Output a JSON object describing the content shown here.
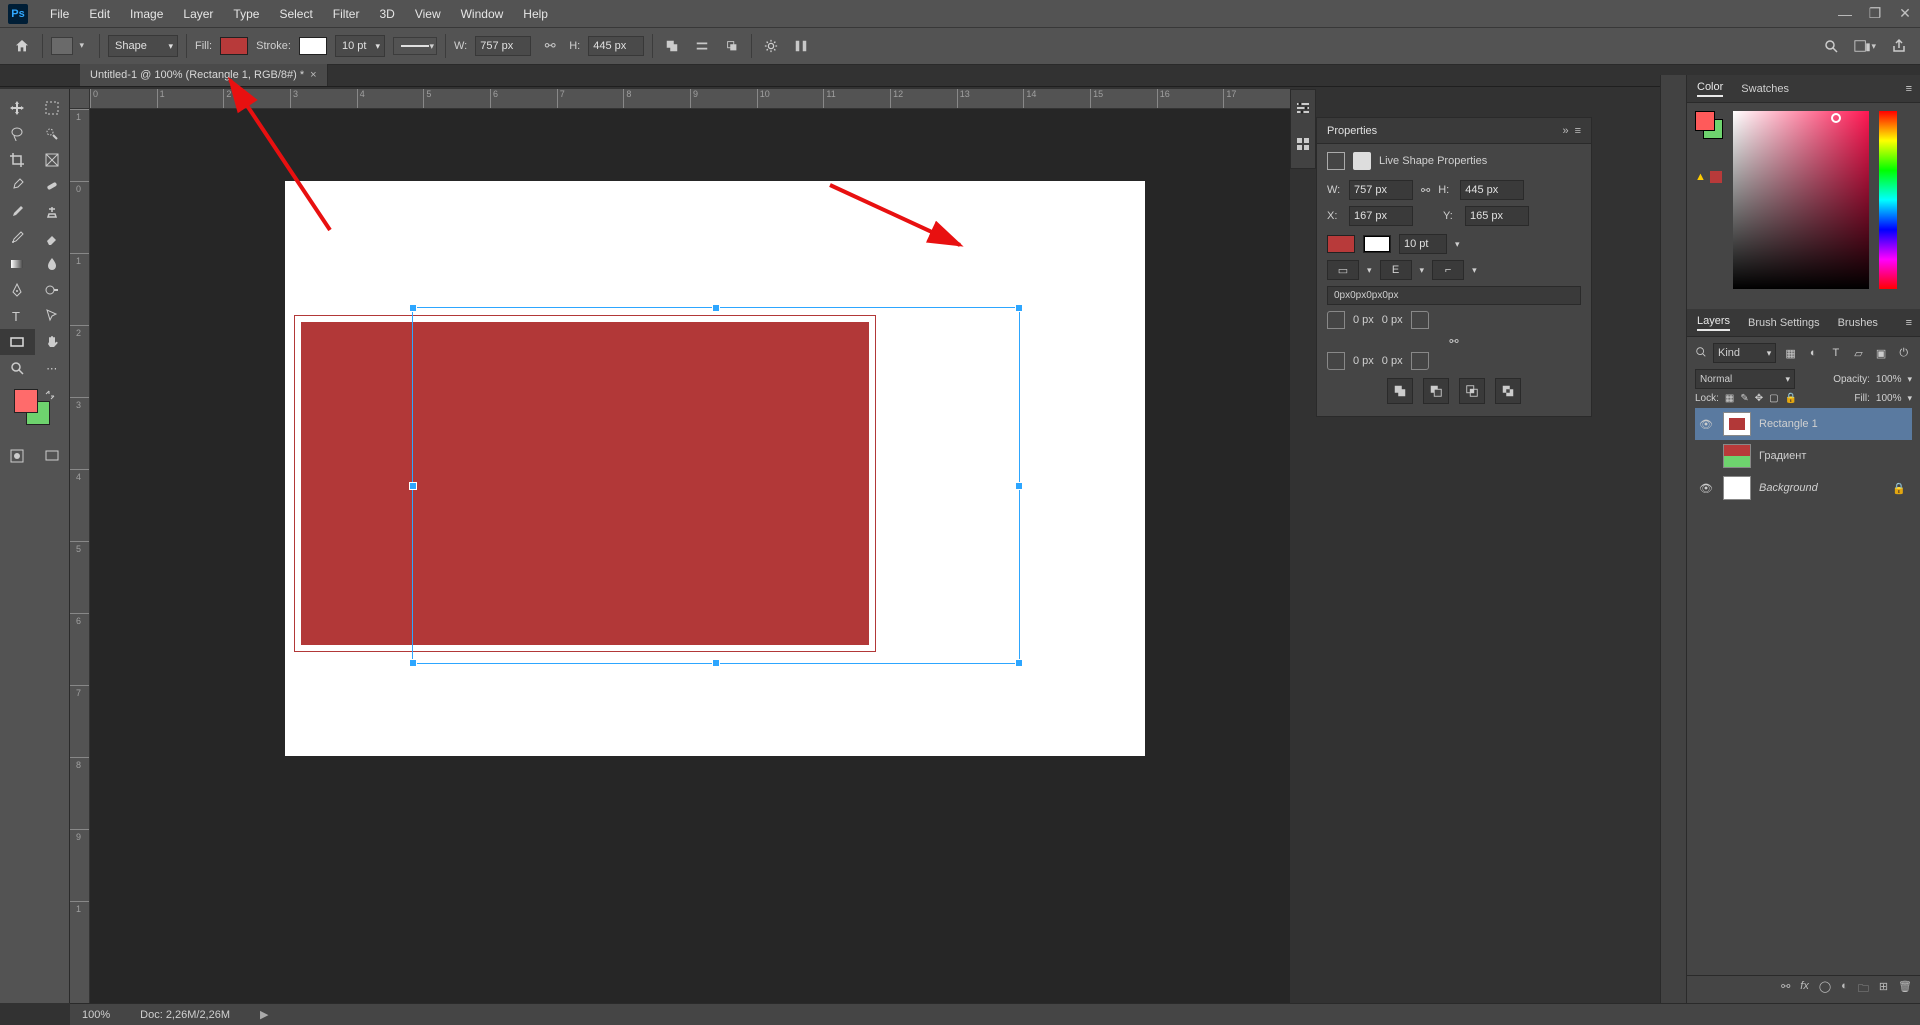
{
  "menu": {
    "items": [
      "File",
      "Edit",
      "Image",
      "Layer",
      "Type",
      "Select",
      "Filter",
      "3D",
      "View",
      "Window",
      "Help"
    ]
  },
  "options": {
    "mode": "Shape",
    "fill_label": "Fill:",
    "stroke_label": "Stroke:",
    "stroke_size": "10 pt",
    "w_label": "W:",
    "w_value": "757 px",
    "h_label": "H:",
    "h_value": "445 px"
  },
  "tab": {
    "title": "Untitled-1 @ 100% (Rectangle 1, RGB/8#) *"
  },
  "rulers": {
    "h": [
      "0",
      "1",
      "2",
      "3",
      "4",
      "5",
      "6",
      "7",
      "8",
      "9",
      "10",
      "11",
      "12",
      "13",
      "14",
      "15",
      "16",
      "17"
    ],
    "v": [
      "1",
      "0",
      "1",
      "2",
      "3",
      "4",
      "5",
      "6",
      "7",
      "8",
      "9",
      "1"
    ]
  },
  "properties": {
    "title": "Properties",
    "shape_title": "Live Shape Properties",
    "w_label": "W:",
    "w": "757 px",
    "h_label": "H:",
    "h": "445 px",
    "x_label": "X:",
    "x": "167 px",
    "y_label": "Y:",
    "y": "165 px",
    "stroke_size": "10 pt",
    "radii_text": "0px0px0px0px",
    "corner": "0 px"
  },
  "color_panel": {
    "tab_color": "Color",
    "tab_swatches": "Swatches"
  },
  "layers_panel": {
    "tab_layers": "Layers",
    "tab_brush": "Brush Settings",
    "tab_brushes": "Brushes",
    "kind": "Kind",
    "blend": "Normal",
    "opacity_label": "Opacity:",
    "opacity": "100%",
    "lock_label": "Lock:",
    "fill_label": "Fill:",
    "fill": "100%",
    "layers": [
      {
        "name": "Rectangle 1",
        "visible": true,
        "active": true,
        "thumb": "rect"
      },
      {
        "name": "Градиент",
        "visible": false,
        "active": false,
        "thumb": "grad"
      },
      {
        "name": "Background",
        "visible": true,
        "active": false,
        "thumb": "white",
        "locked": true,
        "italic": true
      }
    ]
  },
  "status": {
    "zoom": "100%",
    "doc": "Doc: 2,26M/2,26M"
  }
}
